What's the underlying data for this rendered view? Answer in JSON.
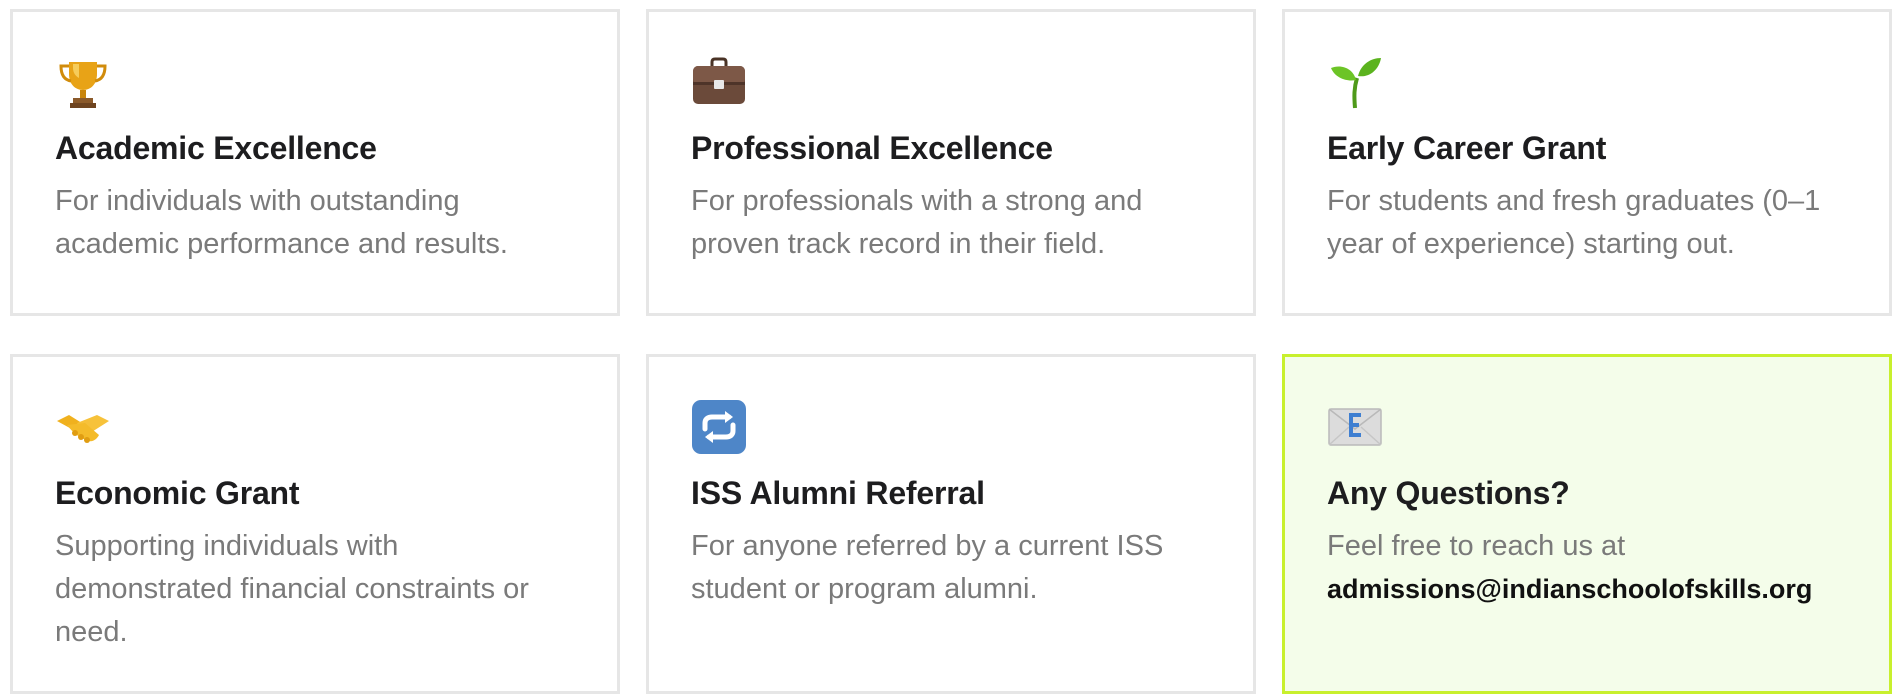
{
  "cards": [
    {
      "icon": "trophy-icon",
      "title": "Academic Excellence",
      "description": "For individuals with outstanding academic performance and results."
    },
    {
      "icon": "briefcase-icon",
      "title": "Professional Excellence",
      "description": "For professionals with a strong and proven track record in their field."
    },
    {
      "icon": "seedling-icon",
      "title": "Early Career Grant",
      "description": "For students and fresh graduates (0–1 year of experience) starting out."
    },
    {
      "icon": "handshake-icon",
      "title": "Economic Grant",
      "description": "Supporting individuals with demonstrated financial constraints or need."
    },
    {
      "icon": "repeat-arrows-icon",
      "title": "ISS Alumni Referral",
      "description": "For anyone referred by a current ISS student or program alumni."
    },
    {
      "icon": "email-envelope-icon",
      "title": "Any Questions?",
      "description": "Feel free to reach us at",
      "email": "admissions@indianschoolofskills.org"
    }
  ],
  "colors": {
    "card_border": "#e6e6e6",
    "highlight_border": "#c8f02d",
    "highlight_background": "#f4fdea",
    "title_text": "#1d1d1f",
    "description_text": "#7a7a7a"
  }
}
